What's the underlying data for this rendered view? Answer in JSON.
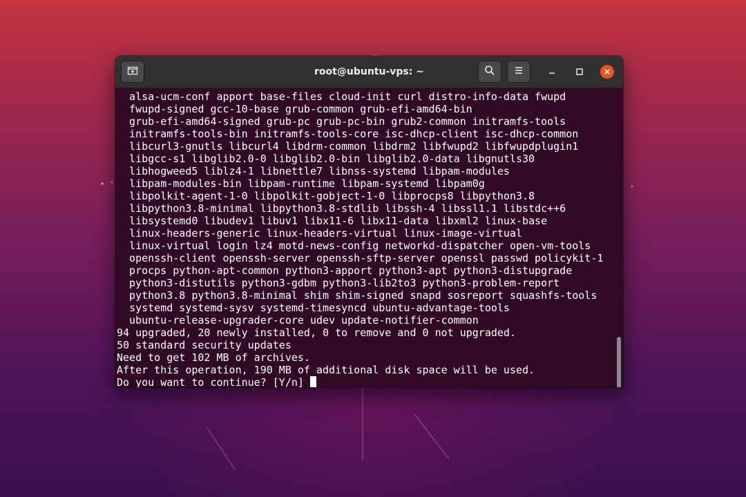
{
  "window": {
    "title": "root@ubuntu-vps: ~",
    "buttons": {
      "new_tab_icon": "new-tab-icon",
      "search_icon": "search-icon",
      "menu_icon": "hamburger-menu-icon",
      "minimize_icon": "minimize-icon",
      "maximize_icon": "maximize-icon",
      "close_icon": "close-icon"
    }
  },
  "colors": {
    "terminal_bg": "#300a24",
    "titlebar_bg": "#303030",
    "close_accent": "#e95420",
    "text": "#ffffff"
  },
  "terminal": {
    "lines": [
      "  alsa-ucm-conf apport base-files cloud-init curl distro-info-data fwupd",
      "  fwupd-signed gcc-10-base grub-common grub-efi-amd64-bin",
      "  grub-efi-amd64-signed grub-pc grub-pc-bin grub2-common initramfs-tools",
      "  initramfs-tools-bin initramfs-tools-core isc-dhcp-client isc-dhcp-common",
      "  libcurl3-gnutls libcurl4 libdrm-common libdrm2 libfwupd2 libfwupdplugin1",
      "  libgcc-s1 libglib2.0-0 libglib2.0-bin libglib2.0-data libgnutls30",
      "  libhogweed5 liblz4-1 libnettle7 libnss-systemd libpam-modules",
      "  libpam-modules-bin libpam-runtime libpam-systemd libpam0g",
      "  libpolkit-agent-1-0 libpolkit-gobject-1-0 libprocps8 libpython3.8",
      "  libpython3.8-minimal libpython3.8-stdlib libssh-4 libssl1.1 libstdc++6",
      "  libsystemd0 libudev1 libuv1 libx11-6 libx11-data libxml2 linux-base",
      "  linux-headers-generic linux-headers-virtual linux-image-virtual",
      "  linux-virtual login lz4 motd-news-config networkd-dispatcher open-vm-tools",
      "  openssh-client openssh-server openssh-sftp-server openssl passwd policykit-1",
      "  procps python-apt-common python3-apport python3-apt python3-distupgrade",
      "  python3-distutils python3-gdbm python3-lib2to3 python3-problem-report",
      "  python3.8 python3.8-minimal shim shim-signed snapd sosreport squashfs-tools",
      "  systemd systemd-sysv systemd-timesyncd ubuntu-advantage-tools",
      "  ubuntu-release-upgrader-core udev update-notifier-common",
      "94 upgraded, 20 newly installed, 0 to remove and 0 not upgraded.",
      "50 standard security updates",
      "Need to get 102 MB of archives.",
      "After this operation, 190 MB of additional disk space will be used."
    ],
    "prompt": "Do you want to continue? [Y/n] "
  }
}
